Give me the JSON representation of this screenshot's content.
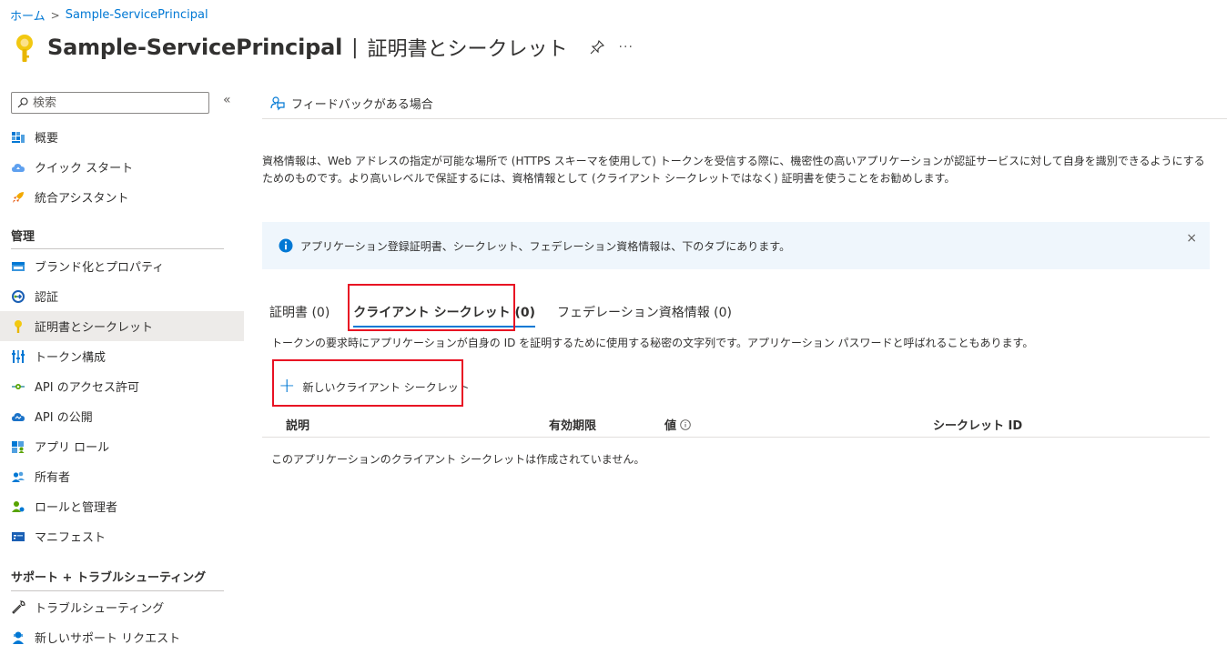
{
  "breadcrumb": {
    "home": "ホーム",
    "sep": ">",
    "current": "Sample-ServicePrincipal"
  },
  "header": {
    "title": "Sample-ServicePrincipal",
    "separator": "|",
    "subtitle": "証明書とシークレット",
    "more": "···"
  },
  "sidebar": {
    "search_placeholder": "検索",
    "collapse": "«",
    "top_items": [
      {
        "label": "概要",
        "icon": "overview-icon"
      },
      {
        "label": "クイック スタート",
        "icon": "cloud-quickstart-icon"
      },
      {
        "label": "統合アシスタント",
        "icon": "rocket-icon"
      }
    ],
    "section_manage": "管理",
    "manage_items": [
      {
        "label": "ブランド化とプロパティ",
        "icon": "branding-icon"
      },
      {
        "label": "認証",
        "icon": "auth-icon"
      },
      {
        "label": "証明書とシークレット",
        "icon": "key-icon"
      },
      {
        "label": "トークン構成",
        "icon": "token-icon"
      },
      {
        "label": "API のアクセス許可",
        "icon": "api-permission-icon"
      },
      {
        "label": "API の公開",
        "icon": "api-cloud-icon"
      },
      {
        "label": "アプリ ロール",
        "icon": "app-roles-icon"
      },
      {
        "label": "所有者",
        "icon": "owners-icon"
      },
      {
        "label": "ロールと管理者",
        "icon": "roles-admins-icon"
      },
      {
        "label": "マニフェスト",
        "icon": "manifest-icon"
      }
    ],
    "section_support": "サポート + トラブルシューティング",
    "support_items": [
      {
        "label": "トラブルシューティング",
        "icon": "wrench-icon"
      },
      {
        "label": "新しいサポート リクエスト",
        "icon": "support-person-icon"
      }
    ]
  },
  "toolbar": {
    "feedback": "フィードバックがある場合"
  },
  "description": "資格情報は、Web アドレスの指定が可能な場所で (HTTPS スキーマを使用して) トークンを受信する際に、機密性の高いアプリケーションが認証サービスに対して自身を識別できるようにするためのものです。より高いレベルで保証するには、資格情報として (クライアント シークレットではなく) 証明書を使うことをお勧めします。",
  "info_banner": {
    "text": "アプリケーション登録証明書、シークレット、フェデレーション資格情報は、下のタブにあります。",
    "close": "×"
  },
  "tabs": [
    {
      "label": "証明書 (0)"
    },
    {
      "label": "クライアント シークレット (0)"
    },
    {
      "label": "フェデレーション資格情報 (0)"
    }
  ],
  "tab_description": "トークンの要求時にアプリケーションが自身の ID を証明するために使用する秘密の文字列です。アプリケーション パスワードと呼ばれることもあります。",
  "new_secret": {
    "plus": "+",
    "label": "新しいクライアント シークレット"
  },
  "table": {
    "columns": [
      "説明",
      "有効期限",
      "値",
      "シークレット ID"
    ],
    "empty": "このアプリケーションのクライアント シークレットは作成されていません。"
  },
  "colors": {
    "accent": "#0078d4",
    "highlight": "#e81123",
    "info_bg": "#eff6fc",
    "key": "#f2c811"
  }
}
